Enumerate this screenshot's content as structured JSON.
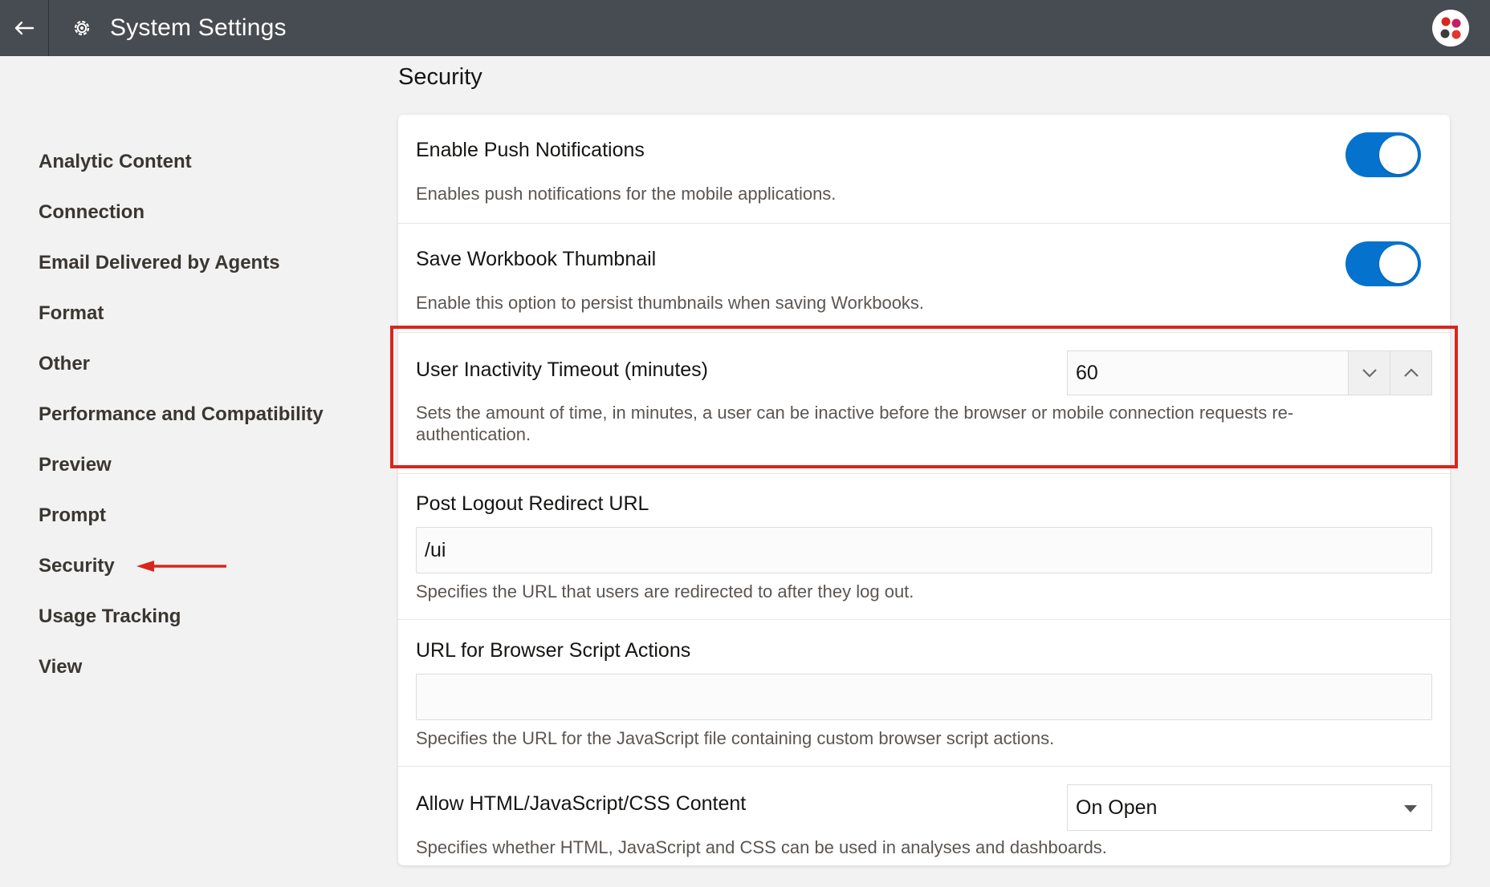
{
  "header": {
    "title": "System Settings"
  },
  "sidebar": {
    "items": [
      {
        "label": "Analytic Content"
      },
      {
        "label": "Connection"
      },
      {
        "label": "Email Delivered by Agents"
      },
      {
        "label": "Format"
      },
      {
        "label": "Other"
      },
      {
        "label": "Performance and Compatibility"
      },
      {
        "label": "Preview"
      },
      {
        "label": "Prompt"
      },
      {
        "label": "Security"
      },
      {
        "label": "Usage Tracking"
      },
      {
        "label": "View"
      }
    ]
  },
  "main": {
    "section_title": "Security",
    "settings": {
      "push": {
        "title": "Enable Push Notifications",
        "desc": "Enables push notifications for the mobile applications.",
        "toggle_on": true
      },
      "thumbnail": {
        "title": "Save Workbook Thumbnail",
        "desc": "Enable this option to persist thumbnails when saving Workbooks.",
        "toggle_on": true
      },
      "timeout": {
        "title": "User Inactivity Timeout (minutes)",
        "desc": "Sets the amount of time, in minutes, a user can be inactive before the browser or mobile connection requests re-authentication.",
        "value": "60"
      },
      "logout": {
        "title": "Post Logout Redirect URL",
        "value": "/ui",
        "desc": "Specifies the URL that users are redirected to after they log out."
      },
      "script": {
        "title": "URL for Browser Script Actions",
        "value": "",
        "desc": "Specifies the URL for the JavaScript file containing custom browser script actions."
      },
      "html": {
        "title": "Allow HTML/JavaScript/CSS Content",
        "selected": "On Open",
        "desc": "Specifies whether HTML, JavaScript and CSS can be used in analyses and dashboards."
      }
    }
  },
  "colors": {
    "header_bg": "#474b52",
    "toggle_on": "#0572ce",
    "annotation": "#d9261c",
    "page_bg": "#f2f2f2"
  }
}
